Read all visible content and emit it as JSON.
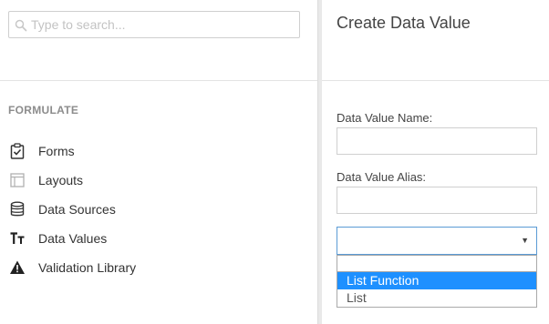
{
  "search": {
    "placeholder": "Type to search...",
    "value": ""
  },
  "sidebar": {
    "section_title": "FORMULATE",
    "items": [
      {
        "label": "Forms",
        "icon": "clipboard-check-icon"
      },
      {
        "label": "Layouts",
        "icon": "layout-icon"
      },
      {
        "label": "Data Sources",
        "icon": "database-icon"
      },
      {
        "label": "Data Values",
        "icon": "text-size-icon"
      },
      {
        "label": "Validation Library",
        "icon": "warning-icon"
      }
    ]
  },
  "form": {
    "title": "Create Data Value",
    "name_label": "Data Value Name:",
    "name_value": "",
    "alias_label": "Data Value Alias:",
    "alias_value": "",
    "type_select_value": "",
    "type_options": [
      "List Function",
      "List"
    ],
    "selected_option": "List Function"
  },
  "colors": {
    "accent": "#1e90ff",
    "select_border": "#5b9bd5",
    "section_title": "#8c8c8c"
  }
}
